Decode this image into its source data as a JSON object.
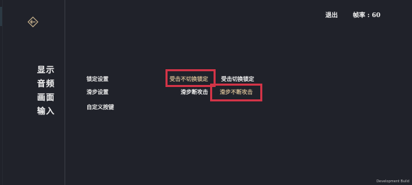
{
  "header": {
    "exit_label": "退出",
    "fps_label": "帧率 : 60"
  },
  "sidebar": {
    "back_icon": "back-arrow-icon",
    "items": [
      {
        "label": "显示"
      },
      {
        "label": "音频"
      },
      {
        "label": "画面"
      },
      {
        "label": "输入"
      }
    ]
  },
  "settings": {
    "rows": [
      {
        "label": "锁定设置",
        "options": [
          "受击不切换锁定",
          "受击切换锁定"
        ],
        "selected": "受击不切换锁定"
      },
      {
        "label": "滑步设置",
        "options": [
          "滑步断攻击",
          "滑步不断攻击"
        ],
        "selected": "滑步不断攻击"
      },
      {
        "label": "自定义按键"
      }
    ]
  },
  "footer": {
    "build_label": "Development Build"
  },
  "colors": {
    "background": "#20222a",
    "selected_option": "#c9b38e",
    "highlight_box": "#d23447",
    "text": "#f0f0f0"
  }
}
